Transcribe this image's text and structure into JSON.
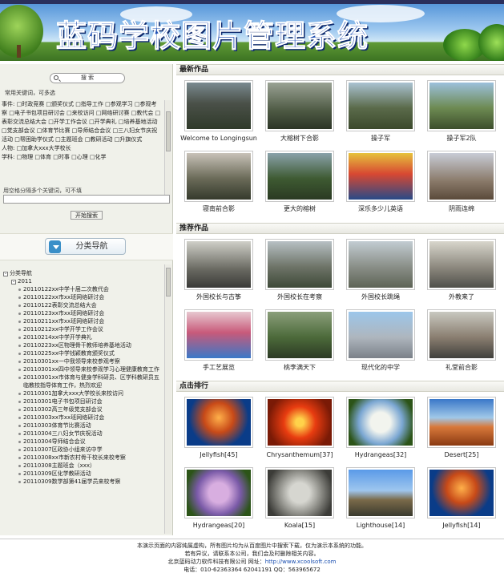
{
  "header": {
    "title": "蓝码学校图片管理系统"
  },
  "search": {
    "button_label": "搜 索",
    "hint": "常用关键词，可多选",
    "multi_hint": "用空格分隔多个关键词，可不填",
    "start_button": "开始搜索"
  },
  "conditions": {
    "text": "事件: □时政竞赛 □颁奖仪式 □指导工作 □参观学习 □参观考察 □电子书包项目研讨会 □来校访问 □网络研讨赛 □教代会 □表彰交流总结大会 □开学工作会议 □开学典礼 □培养基地活动 □党支部会议 □体育节比赛 □导师结合会议 □三八妇女节庆祝活动 □帮困助学仪式 □主题班会 □教研活动 □升旗仪式",
    "people": "人物: □加拿大xxx大学校长",
    "subjects": "学科: □物理 □体育 □时事 □心理 □化学"
  },
  "nav": {
    "title": "分类导航",
    "root": "分类导航",
    "year": "2011",
    "items": [
      "20110122xx中学十届二次教代会",
      "20110122xx市xx班网络研讨会",
      "20110122表彰交流总结大会",
      "20110123xx市xx班网络研讨会",
      "20110211xx市xx班网络研讨会",
      "20110212xx中学开学工作会议",
      "20110214xx中学开学典礼",
      "20110223xx区物理骨干教师培养基地活动",
      "20110225xx中学钱颖教育颁奖仪式",
      "20110301xx一中我领导来校参观考察",
      "20110301xx四中领导来校参观学习心理健康教育工作",
      "20110301xx市体育与健身学科研员、区学科教研员五临教校指导体育工作，热烈欢迎",
      "20110301加拿大xxx大学校长来校访问",
      "20110301电子书包项目研讨会",
      "20110302高三年级党支部会议",
      "20110303xx市xx班网络研讨会",
      "20110303体育节比赛活动",
      "20110304三八妇女节庆祝活动",
      "20110304导师结合会议",
      "20110307区政协小组来访中学",
      "20110308xx市新农村骨干校长来校考察",
      "20110308主题班会（xxx）",
      "20110309区化学教研活动",
      "20110309数学部第41届学员来校考察"
    ]
  },
  "latest": {
    "title": "最新作品",
    "items": [
      "Welcome to Longingsun",
      "大榕树下合影",
      "操子军",
      "操子军2队",
      "寝南前合影",
      "更大的榕树",
      "深乐多少儿英语",
      "阴雨连绵"
    ]
  },
  "recommended": {
    "title": "推荐作品",
    "items": [
      "外国校长与古筝",
      "外国校长在考察",
      "外国校长跳绳",
      "外教来了",
      "手工艺展览",
      "桃李满天下",
      "现代化的中学",
      "礼堂前合影"
    ]
  },
  "ranking": {
    "title": "点击排行",
    "items": [
      "Jellyfish[45]",
      "Chrysanthemum[37]",
      "Hydrangeas[32]",
      "Desert[25]",
      "Hydrangeas[20]",
      "Koala[15]",
      "Lighthouse[14]",
      "Jellyfish[14]"
    ]
  },
  "footer": {
    "line1": "本演示页面的内容纯属虚构，所有图片均为从百度图片中搜索下载，仅为演示本系统的功能。",
    "line2": "若有异议，请联系本公司，我们会及时删除相关内容。",
    "company": "北京蓝码动力软件科技有限公司 网址：",
    "url": "http://www.xcoolsoft.com",
    "contact": "电话：010-62363364 62041191 QQ：563965672"
  }
}
